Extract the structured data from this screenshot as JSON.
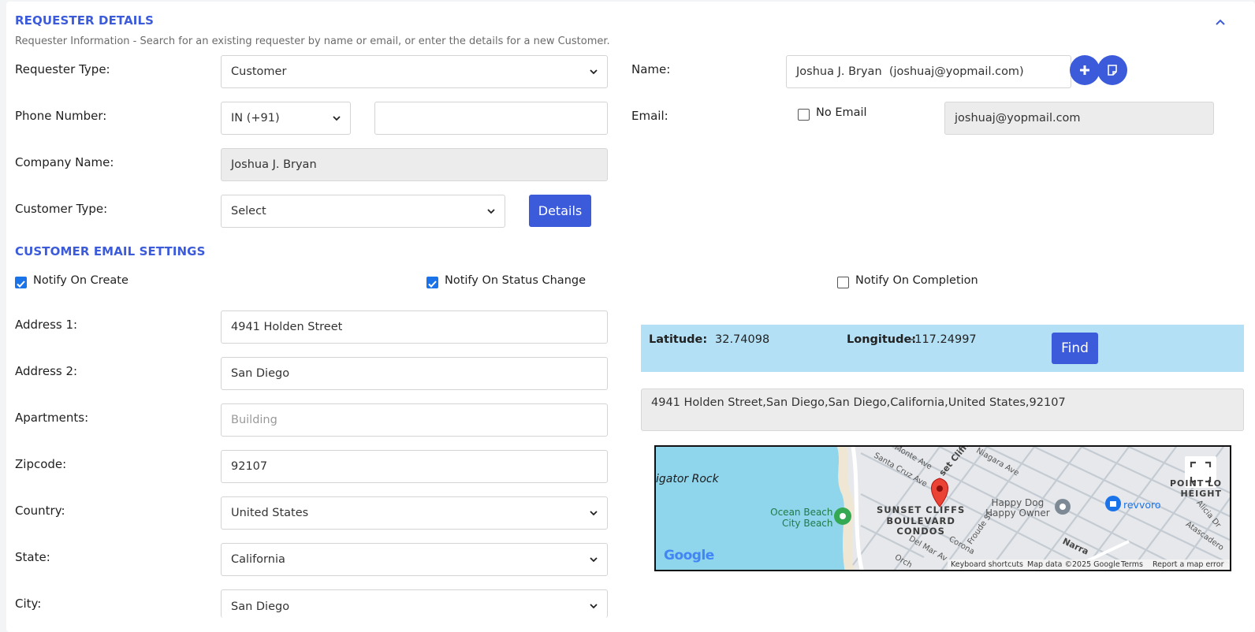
{
  "header": {
    "title": "REQUESTER DETAILS",
    "subtitle": "Requester Information - Search for an existing requester by name or email, or enter the details for a new Customer."
  },
  "requester": {
    "type_label": "Requester Type:",
    "type_value": "Customer",
    "phone_label": "Phone Number:",
    "phone_country": "IN (+91)",
    "phone_value": "",
    "company_label": "Company Name:",
    "company_value": "Joshua J. Bryan",
    "customer_type_label": "Customer Type:",
    "customer_type_value": "Select",
    "details_button": "Details",
    "name_label": "Name:",
    "name_value": "Joshua J. Bryan  (joshuaj@yopmail.com)",
    "email_label": "Email:",
    "no_email_label": "No Email",
    "email_value": "joshuaj@yopmail.com"
  },
  "email_settings": {
    "title": "CUSTOMER EMAIL SETTINGS",
    "notify_create": "Notify On Create",
    "notify_status": "Notify On Status Change",
    "notify_completion": "Notify On Completion",
    "notify_create_checked": true,
    "notify_status_checked": true,
    "notify_completion_checked": false
  },
  "address": {
    "address1_label": "Address 1:",
    "address1_value": "4941 Holden Street",
    "address2_label": "Address 2:",
    "address2_value": "San Diego",
    "apartments_label": "Apartments:",
    "apartments_placeholder": "Building",
    "zipcode_label": "Zipcode:",
    "zipcode_value": "92107",
    "country_label": "Country:",
    "country_value": "United States",
    "state_label": "State:",
    "state_value": "California",
    "city_label": "City:",
    "city_value": "San Diego"
  },
  "geo": {
    "latitude_label": "Latitude:",
    "latitude_value": "32.74098",
    "longitude_label": "Longitude:",
    "longitude_value": "-117.24997",
    "find_button": "Find",
    "full_address": "4941 Holden Street,San Diego,San Diego,California,United States,92107"
  },
  "map": {
    "place_alligator": "igator Rock",
    "place_beach_1": "Ocean Beach",
    "place_beach_2": "City Beach",
    "district_1": "SUNSET CLIFFS",
    "district_2": "BOULEVARD",
    "district_3": "CONDOS",
    "poi_happy_1": "Happy Dog",
    "poi_happy_2": "Happy Owner",
    "poi_revvoro": "revvoro",
    "heights_1": "POINT LO",
    "heights_2": "HEIGHT",
    "street_monte": "Monte Ave",
    "street_santacruz": "Santa Cruz Ave",
    "street_sunset": "set Cliffs",
    "street_niagara": "Niagara Ave",
    "street_froude": "Froude St",
    "street_narra": "Narra",
    "street_delmar": "Del Mar Av",
    "street_corona": "Corona",
    "street_orch": "Orch",
    "street_alicia": "Alicia Dr",
    "street_atascadero": "Atascadero",
    "google_logo": "Google",
    "kb_shortcuts": "Keyboard shortcuts",
    "map_data": "Map data ©2025 Google",
    "terms": "Terms",
    "report": "Report a map error"
  },
  "colors": {
    "accent": "#3b5bdb",
    "coords_bar": "#b3e0f5",
    "water": "#8fd5ec"
  }
}
